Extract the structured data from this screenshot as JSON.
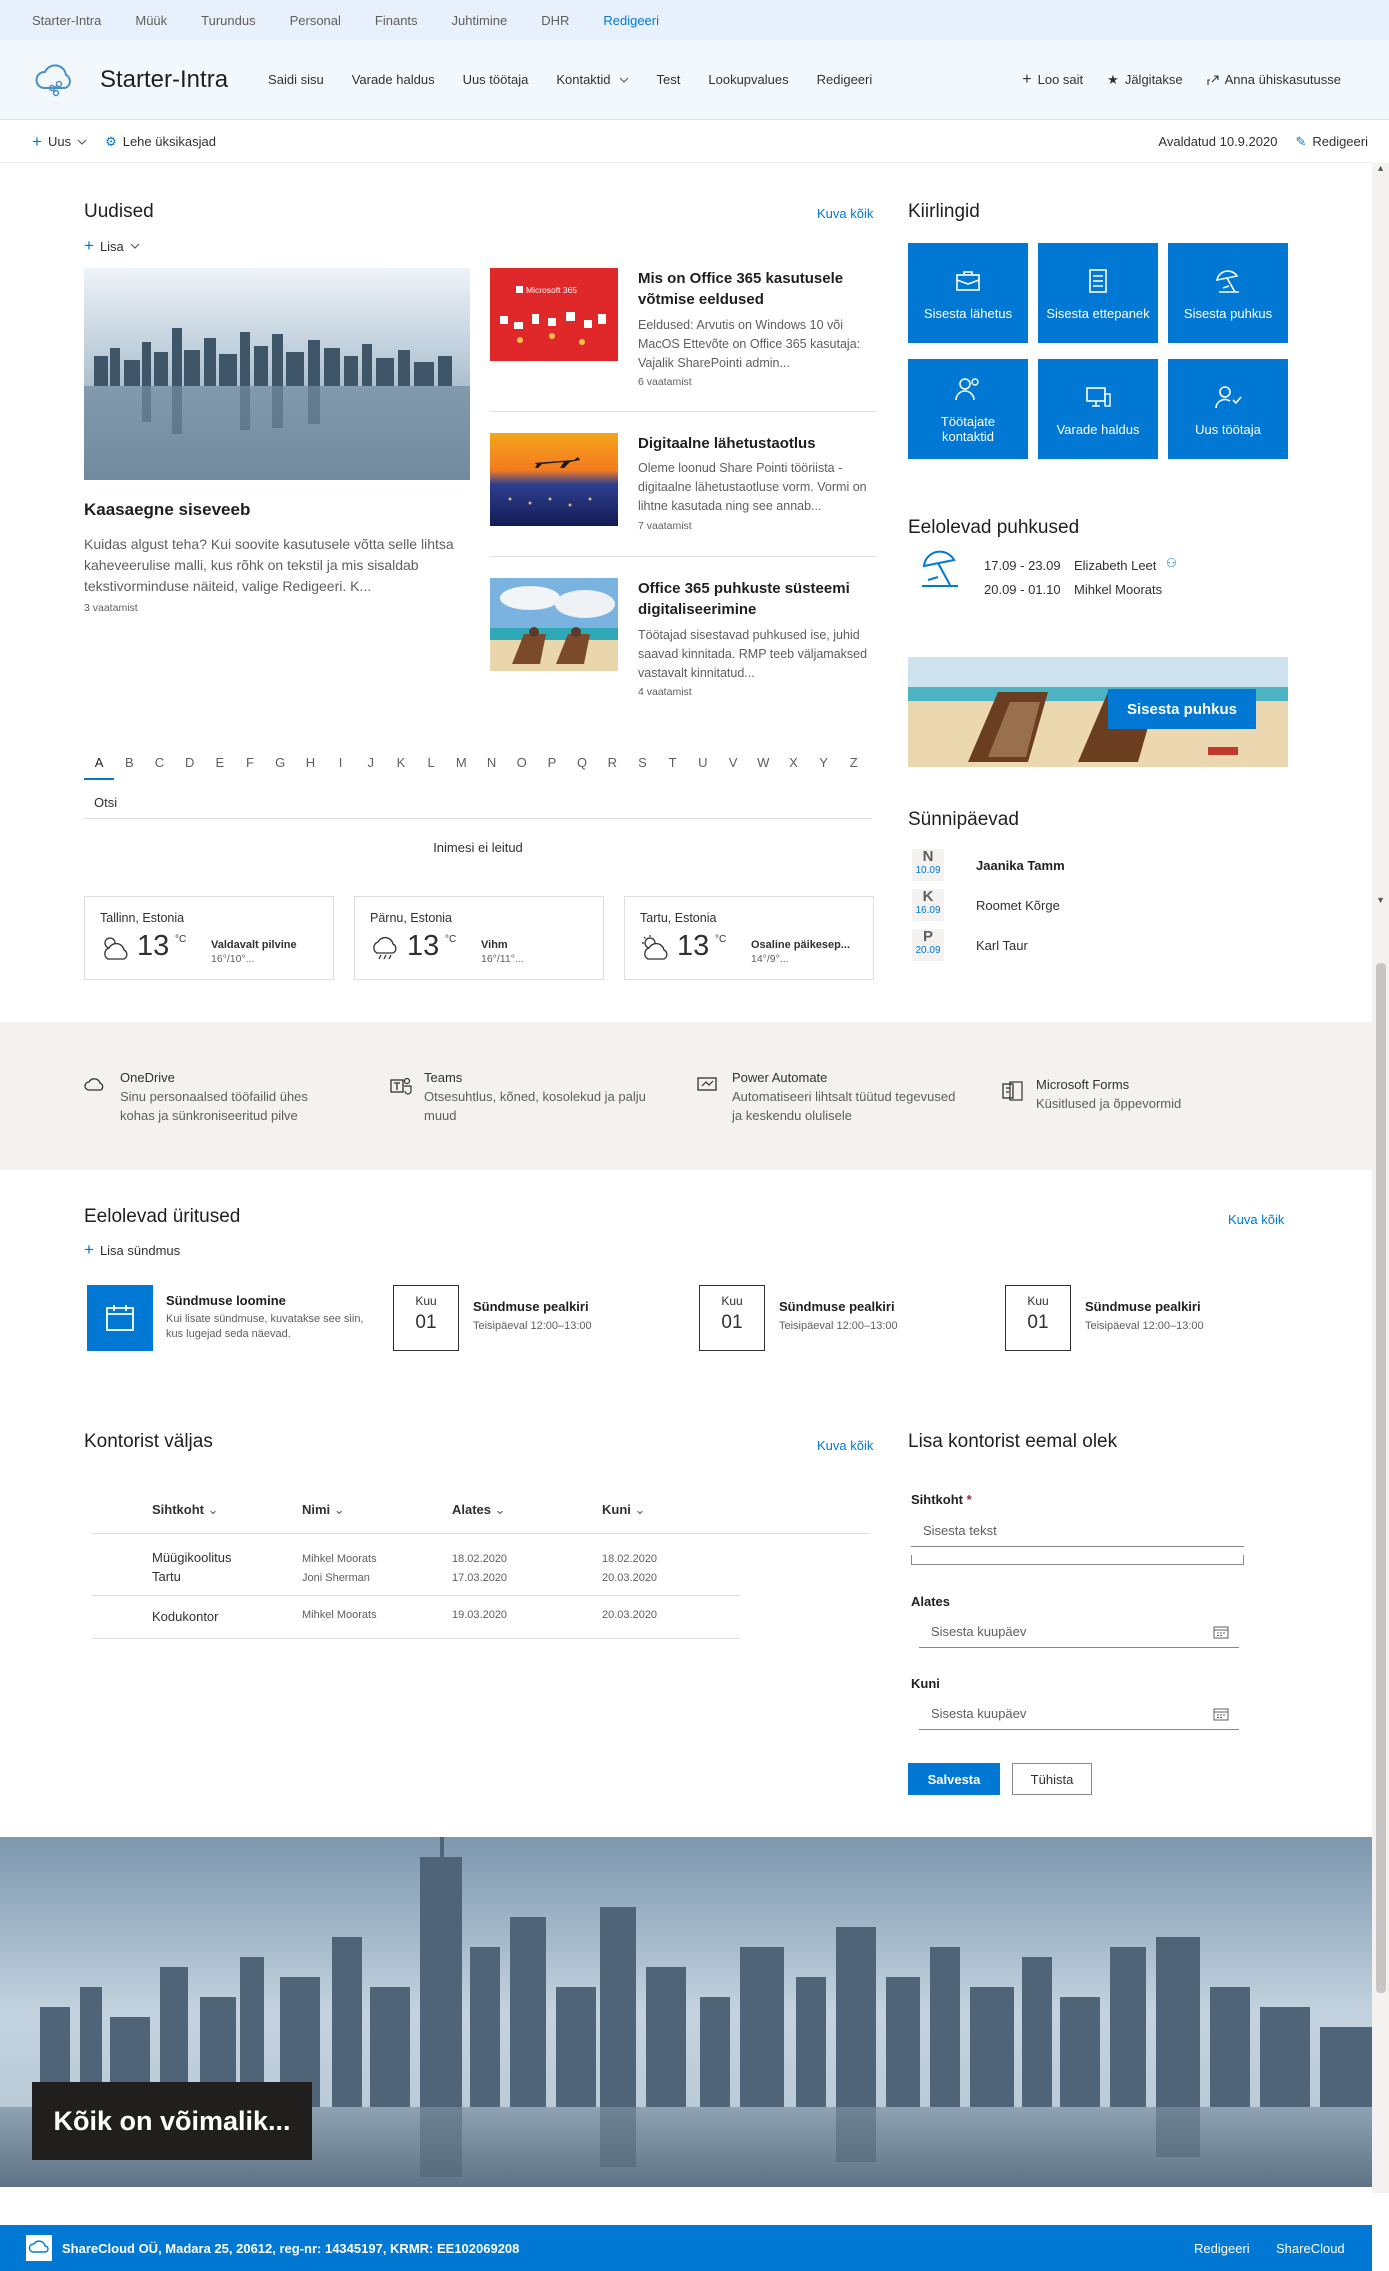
{
  "suite_nav": [
    "Starter-Intra",
    "Müük",
    "Turundus",
    "Personal",
    "Finants",
    "Juhtimine",
    "DHR",
    "Redigeeri"
  ],
  "header": {
    "site_name": "Starter-Intra",
    "nav": [
      "Saidi sisu",
      "Varade haldus",
      "Uus töötaja",
      "Kontaktid",
      "Test",
      "Lookupvalues",
      "Redigeeri"
    ],
    "actions": {
      "create_site": "Loo sait",
      "following": "Jälgitakse",
      "share": "Anna ühiskasutusse"
    }
  },
  "command_bar": {
    "new": "Uus",
    "page_details": "Lehe üksikasjad",
    "published": "Avaldatud 10.9.2020",
    "edit": "Redigeeri"
  },
  "news": {
    "title": "Uudised",
    "see_all": "Kuva kõik",
    "add": "Lisa",
    "hero": {
      "title": "Kaasaegne siseveeb",
      "desc": "Kuidas algust teha? Kui soovite kasutusele võtta selle lihtsa kaheveerulise malli, kus rõhk on tekstil ja mis sisaldab tekstivorminduse näiteid, valige Redigeeri. K...",
      "views": "3 vaatamist"
    },
    "items": [
      {
        "title": "Mis on Office 365 kasutusele võtmise eeldused",
        "desc": "Eeldused: Arvutis on Windows 10 või MacOS Ettevõte on Office 365 kasutaja: Vajalik SharePointi admin...",
        "views": "6 vaatamist",
        "thumb_label": "Microsoft 365"
      },
      {
        "title": "Digitaalne lähetustaotlus",
        "desc": "Oleme loonud Share Pointi tööriista - digitaalne lähetustaotluse vorm. Vormi on lihtne kasutada ning see annab...",
        "views": "7 vaatamist"
      },
      {
        "title": "Office 365 puhkuste süsteemi digitaliseerimine",
        "desc": "Töötajad sisestavad puhkused ise, juhid saavad kinnitada. RMP teeb väljamaksed vastavalt kinnitatud...",
        "views": "4 vaatamist"
      }
    ]
  },
  "people": {
    "letters": [
      "A",
      "B",
      "C",
      "D",
      "E",
      "F",
      "G",
      "H",
      "I",
      "J",
      "K",
      "L",
      "M",
      "N",
      "O",
      "P",
      "Q",
      "R",
      "S",
      "T",
      "U",
      "V",
      "W",
      "X",
      "Y",
      "Z"
    ],
    "search_label": "Otsi",
    "not_found": "Inimesi ei leitud"
  },
  "weather": [
    {
      "city": "Tallinn, Estonia",
      "temp": "13",
      "unit": "°C",
      "desc": "Valdavalt pilvine",
      "range": "16°/10°..."
    },
    {
      "city": "Pärnu, Estonia",
      "temp": "13",
      "unit": "°C",
      "desc": "Vihm",
      "range": "16°/11°..."
    },
    {
      "city": "Tartu, Estonia",
      "temp": "13",
      "unit": "°C",
      "desc": "Osaline päikesep...",
      "range": "14°/9°..."
    }
  ],
  "quick_links": {
    "title": "Kiirlingid",
    "items": [
      {
        "label": "Sisesta lähetus",
        "icon": "briefcase-icon"
      },
      {
        "label": "Sisesta ettepanek",
        "icon": "checklist-icon"
      },
      {
        "label": "Sisesta puhkus",
        "icon": "beach-icon"
      },
      {
        "label": "Töötajate kontaktid",
        "icon": "contacts-icon"
      },
      {
        "label": "Varade haldus",
        "icon": "devices-icon"
      },
      {
        "label": "Uus töötaja",
        "icon": "new-user-icon"
      }
    ]
  },
  "holidays": {
    "title": "Eelolevad puhkused",
    "items": [
      {
        "dates": "17.09 - 23.09",
        "name": "Elizabeth Leet"
      },
      {
        "dates": "20.09 - 01.10",
        "name": "Mihkel Moorats"
      }
    ],
    "banner_button": "Sisesta puhkus"
  },
  "birthdays": {
    "title": "Sünnipäevad",
    "items": [
      {
        "day": "N",
        "date": "10.09",
        "name": "Jaanika Tamm"
      },
      {
        "day": "K",
        "date": "16.09",
        "name": "Roomet Kõrge"
      },
      {
        "day": "P",
        "date": "20.09",
        "name": "Karl Taur"
      }
    ]
  },
  "apps": [
    {
      "name": "OneDrive",
      "desc": "Sinu personaalsed tööfailid ühes kohas ja sünkroniseeritud pilve"
    },
    {
      "name": "Teams",
      "desc": "Otsesuhtlus, kõned, kosolekud ja palju muud"
    },
    {
      "name": "Power Automate",
      "desc": "Automatiseeri lihtsalt tüütud tegevused ja keskendu olulisele"
    },
    {
      "name": "Microsoft Forms",
      "desc": "Küsitlused ja õppevormid"
    }
  ],
  "events": {
    "title": "Eelolevad üritused",
    "see_all": "Kuva kõik",
    "add": "Lisa sündmus",
    "create": {
      "title": "Sündmuse loomine",
      "desc": "Kui lisate sündmuse, kuvatakse see siin, kus lugejad seda näevad."
    },
    "items": [
      {
        "month": "Kuu",
        "day": "01",
        "title": "Sündmuse pealkiri",
        "time": "Teisipäeval 12:00–13:00"
      },
      {
        "month": "Kuu",
        "day": "01",
        "title": "Sündmuse pealkiri",
        "time": "Teisipäeval 12:00–13:00"
      },
      {
        "month": "Kuu",
        "day": "01",
        "title": "Sündmuse pealkiri",
        "time": "Teisipäeval 12:00–13:00"
      }
    ]
  },
  "out_of_office": {
    "title": "Kontorist väljas",
    "see_all": "Kuva kõik",
    "columns": [
      "Sihtkoht",
      "Nimi",
      "Alates",
      "Kuni"
    ],
    "rows": [
      {
        "dest": "Müügikoolitus",
        "dest2": "Tartu",
        "name": "Mihkel Moorats",
        "name2": "Joni Sherman",
        "from": "18.02.2020",
        "from2": "17.03.2020",
        "to": "18.02.2020",
        "to2": "20.03.2020"
      },
      {
        "dest": "Kodukontor",
        "dest2": "",
        "name": "Mihkel Moorats",
        "name2": "",
        "from": "19.03.2020",
        "from2": "",
        "to": "20.03.2020",
        "to2": ""
      }
    ]
  },
  "form": {
    "title": "Lisa kontorist eemal olek",
    "dest_label": "Sihtkoht",
    "dest_placeholder": "Sisesta tekst",
    "from_label": "Alates",
    "to_label": "Kuni",
    "date_placeholder": "Sisesta kuupäev",
    "save": "Salvesta",
    "cancel": "Tühista"
  },
  "hero_banner": {
    "text": "Kõik on võimalik..."
  },
  "footer": {
    "company": "ShareCloud OÜ, Madara 25, 20612, reg-nr: 14345197, KRMR: EE102069208",
    "edit": "Redigeeri",
    "brand": "ShareCloud"
  },
  "colors": {
    "accent": "#0078d4",
    "suite_bg": "#e8f1fb",
    "band_bg": "#f3f2f1"
  }
}
